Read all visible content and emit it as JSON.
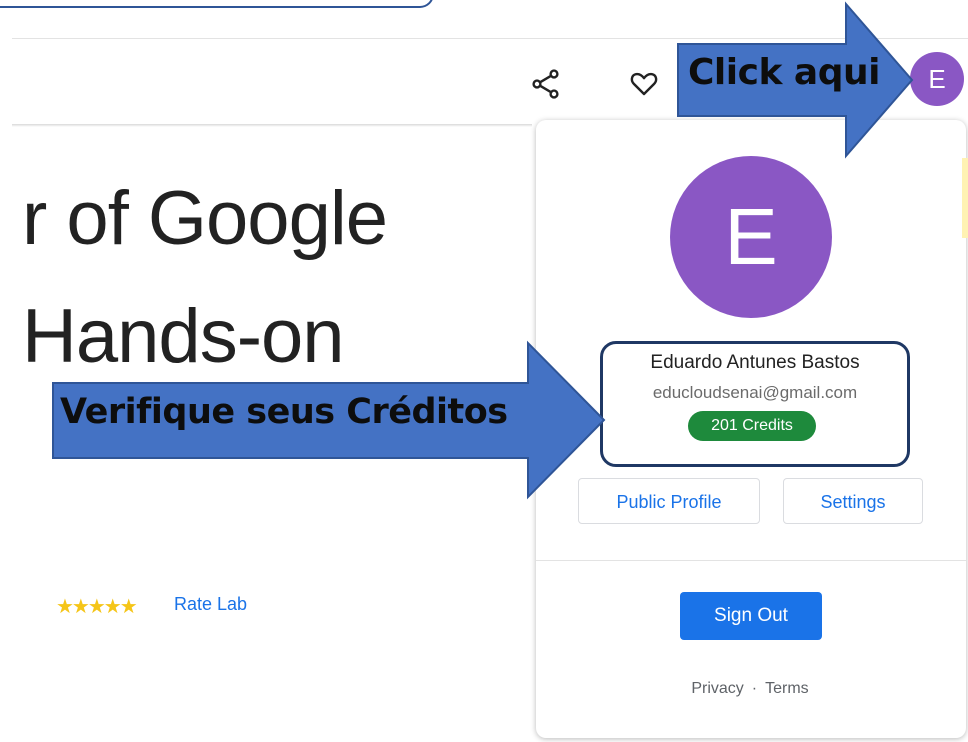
{
  "page": {
    "lab_title": "r of Google\nHands-on",
    "rating": {
      "stars": 5,
      "stars_glyph": "★★★★★",
      "rate_label": "Rate Lab"
    }
  },
  "header": {
    "icons": [
      "share-icon",
      "heart-icon"
    ],
    "avatar_initial": "E",
    "avatar_color": "#8a57c4"
  },
  "profile_popup": {
    "avatar_initial": "E",
    "name": "Eduardo Antunes Bastos",
    "email": "educloudsenai@gmail.com",
    "credits_label": "201 Credits",
    "credits_color": "#1e8a3c",
    "buttons": {
      "public_profile": "Public Profile",
      "settings": "Settings",
      "sign_out": "Sign Out"
    },
    "footer": {
      "privacy": "Privacy",
      "separator": "·",
      "terms": "Terms"
    }
  },
  "annotations": {
    "click_here": "Click aqui",
    "check_credits": "Verifique seus Créditos",
    "arrow_color": "#4472c4"
  }
}
